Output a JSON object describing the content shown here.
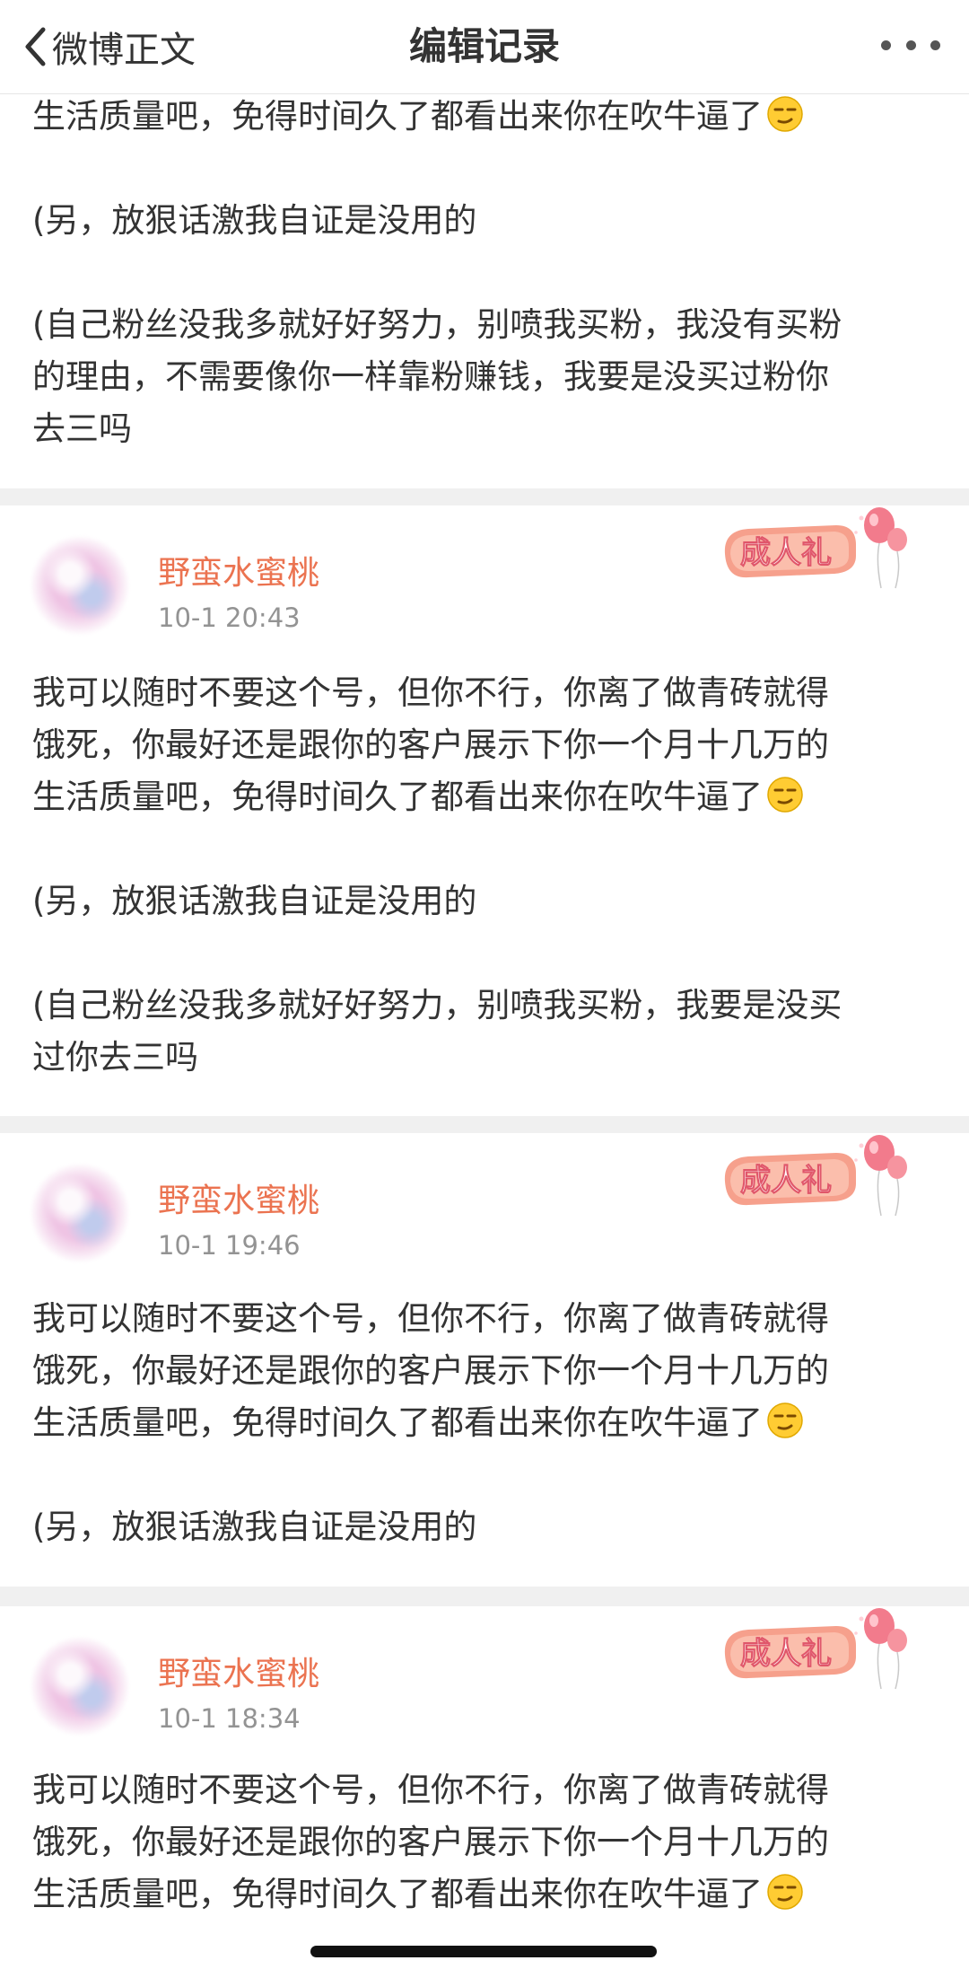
{
  "nav": {
    "back_label": "微博正文",
    "title": "编辑记录"
  },
  "top_card": {
    "lines": [
      "生活质量吧，免得时间久了都看出来你在吹牛逼了",
      "",
      "(另，放狠话激我自证是没用的",
      "",
      "(自己粉丝没我多就好好努力，别喷我买粉，我没有买粉",
      "的理由，不需要像你一样靠粉赚钱，我要是没买过粉你",
      "去三吗"
    ]
  },
  "records": [
    {
      "username": "野蛮水蜜桃",
      "time": "10-1 20:43",
      "badge": "成人礼",
      "lines": [
        "我可以随时不要这个号，但你不行，你离了做青砖就得",
        "饿死，你最好还是跟你的客户展示下你一个月十几万的",
        "生活质量吧，免得时间久了都看出来你在吹牛逼了",
        "",
        "(另，放狠话激我自证是没用的",
        "",
        "(自己粉丝没我多就好好努力，别喷我买粉，我要是没买",
        "过你去三吗"
      ]
    },
    {
      "username": "野蛮水蜜桃",
      "time": "10-1 19:46",
      "badge": "成人礼",
      "lines": [
        "我可以随时不要这个号，但你不行，你离了做青砖就得",
        "饿死，你最好还是跟你的客户展示下你一个月十几万的",
        "生活质量吧，免得时间久了都看出来你在吹牛逼了",
        "",
        "(另，放狠话激我自证是没用的"
      ]
    },
    {
      "username": "野蛮水蜜桃",
      "time": "10-1 18:34",
      "badge": "成人礼",
      "lines": [
        "我可以随时不要这个号，但你不行，你离了做青砖就得",
        "饿死，你最好还是跟你的客户展示下你一个月十几万的",
        "生活质量吧，免得时间久了都看出来你在吹牛逼了"
      ]
    }
  ],
  "icons": {
    "back": "chevron-left-icon",
    "more": "more-dots-icon",
    "emoji": "smirk-emoji-icon",
    "badge": "coming-of-age-badge-balloons"
  },
  "colors": {
    "username": "#eb7350",
    "timestamp": "#939393",
    "text": "#333333",
    "separator": "#f0f0f0",
    "badge_pink": "#f26b7c"
  }
}
